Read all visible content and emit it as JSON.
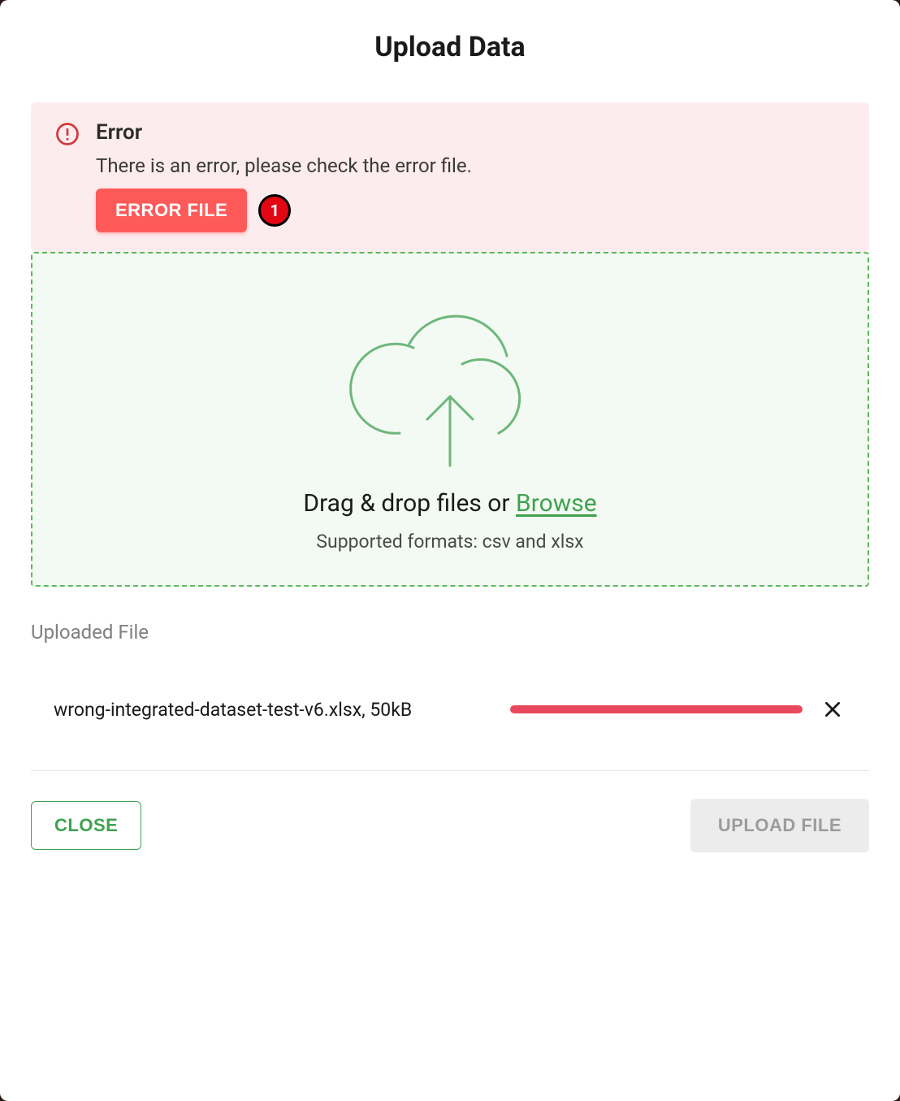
{
  "modal": {
    "title": "Upload Data"
  },
  "error": {
    "title": "Error",
    "message": "There is an error, please check the error file.",
    "button_label": "ERROR FILE",
    "badge_count": "1"
  },
  "dropzone": {
    "prompt_prefix": "Drag & drop files or ",
    "browse_label": "Browse",
    "supported_text": "Supported formats: csv and xlsx"
  },
  "uploaded": {
    "section_label": "Uploaded File",
    "file_display": "wrong-integrated-dataset-test-v6.xlsx, 50kB"
  },
  "footer": {
    "close_label": "CLOSE",
    "upload_label": "UPLOAD FILE"
  },
  "colors": {
    "accent_green": "#3fa24f",
    "error_red": "#e30613",
    "progress_pink": "#e9485b",
    "error_bg": "#fdecee",
    "drop_bg": "#f3faf3"
  }
}
